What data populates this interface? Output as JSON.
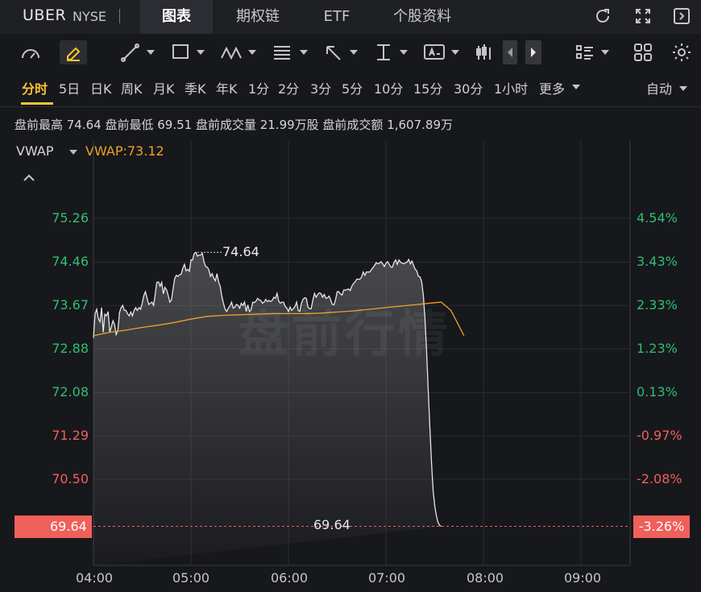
{
  "header": {
    "ticker": "UBER",
    "exchange": "NYSE",
    "tabs": [
      {
        "label": "图表",
        "active": true
      },
      {
        "label": "期权链",
        "active": false
      },
      {
        "label": "ETF",
        "active": false
      },
      {
        "label": "个股资料",
        "active": false
      }
    ],
    "icons": [
      "refresh-icon",
      "fullscreen-icon",
      "sidebar-toggle-icon"
    ]
  },
  "toolbar": {
    "tools": [
      "gauge-icon",
      "highlighter-icon",
      "trendline-icon",
      "rectangle-icon",
      "pattern-icon",
      "fibonacci-icon",
      "arrow-icon",
      "measure-icon",
      "text-annotation-icon",
      "candlestick-icon",
      "scroll-left-icon",
      "scroll-right-icon",
      "layout-list-icon",
      "grid-icon",
      "settings-icon"
    ]
  },
  "periods": {
    "items": [
      "分时",
      "5日",
      "日K",
      "周K",
      "月K",
      "季K",
      "年K",
      "1分",
      "2分",
      "3分",
      "5分",
      "10分",
      "15分",
      "30分",
      "1小时",
      "更多"
    ],
    "active": "分时",
    "mode": "自动"
  },
  "stats": {
    "text": "盘前最高 74.64  盘前最低 69.51  盘前成交量 21.99万股  盘前成交额 1,607.89万"
  },
  "indicator": {
    "name": "VWAP",
    "value_label": "VWAP:73.12"
  },
  "watermark": "盘前行情",
  "colors": {
    "background": "#17181c",
    "up": "#2fbf71",
    "down": "#f0605a",
    "vwap": "#f0a028",
    "accent": "#f7c531",
    "price_line": "#e6e6e8"
  },
  "chart_data": {
    "type": "line",
    "title": "",
    "xlabel": "",
    "ylabel": "",
    "x_ticks": [
      "04:00",
      "05:00",
      "06:00",
      "07:00",
      "08:00",
      "09:00"
    ],
    "y_ticks_left": [
      "75.26",
      "74.46",
      "73.67",
      "72.88",
      "72.08",
      "71.29",
      "70.50"
    ],
    "y_ticks_right": [
      "4.54%",
      "3.43%",
      "2.33%",
      "1.23%",
      "0.13%",
      "-0.97%",
      "-2.08%"
    ],
    "current_price": "69.64",
    "current_pct": "-3.26%",
    "current_marker_label": "69.64",
    "high_marker_label": "74.64",
    "ylim": [
      69.64,
      75.26
    ],
    "xlim_minutes": [
      0,
      330
    ],
    "grid": true,
    "series": [
      {
        "key": "price",
        "x_minutes": [
          0,
          1,
          2,
          3,
          4,
          5,
          6,
          7,
          8,
          9,
          10,
          11,
          12,
          13,
          14,
          15,
          16,
          17,
          18,
          19,
          20,
          21,
          22,
          23,
          24,
          25,
          26,
          27,
          28,
          29,
          30,
          31,
          32,
          33,
          34,
          35,
          36,
          37,
          38,
          39,
          40,
          41,
          42,
          43,
          44,
          45,
          46,
          47,
          48,
          49,
          50,
          51,
          52,
          53,
          54,
          55,
          56,
          57,
          58,
          59,
          60,
          61,
          62,
          63,
          64,
          65,
          66,
          67,
          68,
          69,
          70,
          71,
          72,
          73,
          74,
          75,
          76,
          77,
          78,
          79,
          80,
          81,
          82,
          83,
          84,
          85,
          86,
          87,
          88,
          89,
          90,
          91,
          92,
          93,
          94,
          95,
          96,
          97,
          98,
          99,
          100,
          101,
          102,
          103,
          104,
          105,
          106,
          107,
          108,
          109,
          110,
          111,
          112,
          113,
          114,
          115,
          116,
          117,
          118,
          119,
          120,
          121,
          122,
          123,
          124,
          125,
          126,
          127,
          128,
          129,
          130,
          131,
          132,
          133,
          134,
          135,
          136,
          137,
          138,
          139,
          140,
          141,
          142,
          143,
          144,
          145,
          146,
          147,
          148,
          149,
          150,
          151,
          152,
          153,
          154,
          155,
          156,
          157,
          158,
          159,
          160,
          161,
          162,
          163,
          164,
          165,
          166,
          167,
          168,
          169,
          170,
          171,
          172,
          173,
          174,
          175,
          176,
          177,
          178,
          179,
          180,
          181,
          182,
          183,
          184,
          185,
          186,
          187,
          188,
          189,
          190,
          191,
          192,
          193,
          194,
          195,
          196,
          197,
          198,
          199,
          200,
          201,
          202,
          203,
          204,
          205,
          206,
          207,
          208,
          209,
          210,
          211,
          212,
          213,
          214,
          215,
          216,
          217,
          218,
          219,
          220,
          221,
          222,
          223,
          224,
          225,
          226,
          227,
          228,
          229,
          230,
          231,
          232,
          233,
          234,
          235,
          236,
          237,
          238,
          239,
          240,
          241,
          242,
          243,
          244,
          245,
          246,
          247,
          248,
          249,
          250,
          251,
          252,
          253,
          254,
          255,
          256,
          257,
          258,
          259,
          260,
          261,
          262,
          263,
          264,
          265,
          266,
          267,
          268,
          269,
          270,
          271,
          272,
          273,
          274,
          275,
          276,
          277,
          278,
          279,
          280,
          281,
          282,
          283,
          284,
          285,
          286,
          287,
          288,
          289,
          290,
          291,
          292,
          293,
          294,
          295,
          296,
          297,
          298,
          299,
          300,
          301,
          302,
          303,
          304,
          305,
          306,
          307,
          308,
          309,
          310,
          311,
          312,
          313,
          314,
          315,
          316,
          317,
          318,
          319,
          320,
          321,
          322,
          323,
          324,
          325,
          326,
          327,
          328,
          329,
          330
        ],
        "values": [
          73.08,
          73.52,
          73.6,
          73.43,
          73.37,
          73.63,
          73.18,
          73.51,
          73.48,
          73.56,
          73.18,
          73.28,
          73.39,
          73.32,
          73.14,
          73.21,
          73.54,
          73.63,
          73.67,
          73.58,
          73.58,
          73.52,
          73.48,
          73.55,
          73.48,
          73.58,
          73.63,
          73.58,
          73.63,
          73.6,
          73.71,
          73.85,
          73.92,
          73.8,
          73.69,
          73.71,
          73.73,
          73.67,
          73.87,
          74.09,
          74.1,
          74.02,
          74.09,
          73.88,
          74.0,
          73.95,
          73.85,
          73.73,
          73.77,
          73.97,
          74.16,
          74.22,
          74.2,
          74.23,
          74.24,
          74.35,
          74.42,
          74.3,
          74.33,
          74.29,
          74.5,
          74.5,
          74.62,
          74.64,
          74.57,
          74.59,
          74.59,
          74.62,
          74.47,
          74.38,
          74.37,
          74.32,
          74.2,
          74.25,
          74.17,
          74.12,
          74.25,
          74.1,
          74.02,
          73.84,
          73.71,
          73.6,
          73.56,
          73.62,
          73.66,
          73.73,
          73.62,
          73.64,
          73.69,
          73.67,
          73.62,
          73.71,
          73.67,
          73.73,
          73.56,
          73.68,
          73.56,
          73.59,
          73.73,
          73.72,
          73.75,
          73.8,
          73.77,
          73.76,
          73.71,
          73.73,
          73.78,
          73.74,
          73.76,
          73.74,
          73.76,
          73.82,
          73.8,
          73.89,
          73.75,
          73.71,
          73.73,
          73.73,
          73.65,
          73.62,
          73.56,
          73.64,
          73.58,
          73.61,
          73.65,
          73.73,
          73.58,
          73.56,
          73.71,
          73.78,
          73.81,
          73.8,
          73.64,
          73.61,
          73.61,
          73.77,
          73.89,
          73.82,
          73.87,
          73.9,
          73.89,
          73.82,
          73.87,
          73.8,
          73.81,
          73.84,
          73.77,
          73.69,
          73.68,
          73.78,
          73.92,
          73.92,
          73.88,
          73.86,
          73.95,
          73.95,
          73.96,
          73.97,
          73.94,
          74.02,
          74.07,
          74.1,
          74.15,
          74.15,
          74.15,
          74.19,
          74.28,
          74.22,
          74.28,
          74.28,
          74.28,
          74.32,
          74.36,
          74.4,
          74.45,
          74.43,
          74.44,
          74.47,
          74.43,
          74.38,
          74.44,
          74.47,
          74.42,
          74.37,
          74.37,
          74.46,
          74.5,
          74.42,
          74.5,
          74.46,
          74.44,
          74.43,
          74.45,
          74.46,
          74.51,
          74.43,
          74.48,
          74.4,
          74.33,
          74.3,
          74.2,
          74.19,
          74.1,
          73.85,
          73.44,
          72.85,
          72.15,
          71.45,
          70.82,
          70.3,
          70.02,
          69.84,
          69.72,
          69.66,
          69.64
        ],
        "note_ignore": ""
      },
      {
        "key": "vwap",
        "x_minutes": [
          0,
          10,
          20,
          30,
          40,
          50,
          60,
          70,
          80,
          90,
          100,
          110,
          120,
          130,
          140,
          150,
          160,
          170,
          180,
          190,
          200,
          210,
          214,
          220,
          228
        ],
        "values": [
          73.12,
          73.18,
          73.22,
          73.27,
          73.31,
          73.36,
          73.42,
          73.47,
          73.49,
          73.5,
          73.51,
          73.52,
          73.52,
          73.52,
          73.53,
          73.55,
          73.57,
          73.6,
          73.63,
          73.66,
          73.69,
          73.72,
          73.73,
          73.58,
          73.12
        ]
      }
    ]
  }
}
